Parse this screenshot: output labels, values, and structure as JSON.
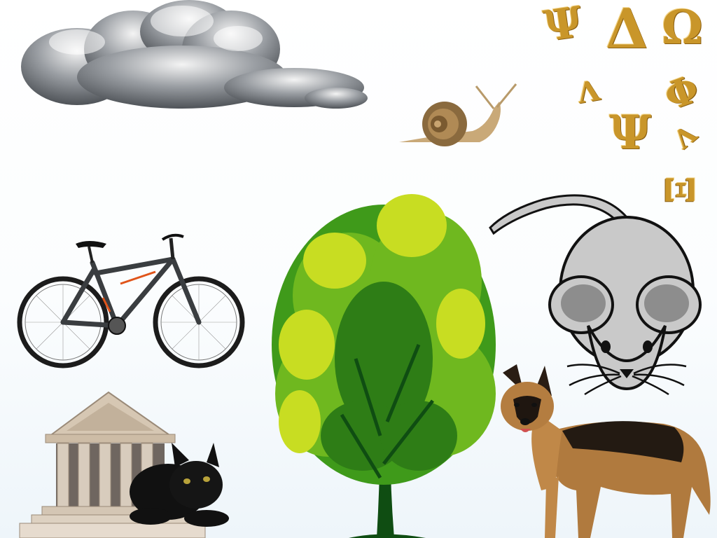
{
  "scene": {
    "background": "#ffffff",
    "objects": [
      {
        "name": "cloud"
      },
      {
        "name": "snail"
      },
      {
        "name": "greek-letters"
      },
      {
        "name": "bicycle"
      },
      {
        "name": "tree"
      },
      {
        "name": "mouse"
      },
      {
        "name": "temple"
      },
      {
        "name": "black-cat"
      },
      {
        "name": "dog"
      }
    ]
  },
  "greek_letters": {
    "color": "#c9962a",
    "glyphs": [
      "Ψ",
      "Δ",
      "Ω",
      "Λ",
      "Φ",
      "Ψ",
      "Λ",
      "Ξ"
    ]
  }
}
